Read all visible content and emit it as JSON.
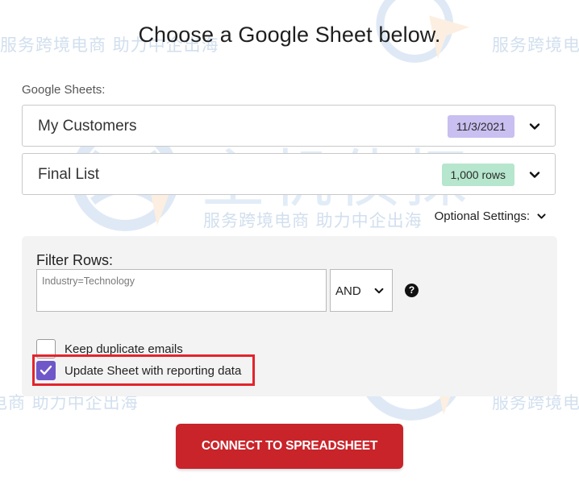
{
  "title": "Choose a Google Sheet below.",
  "sheets_label": "Google Sheets:",
  "sheets": [
    {
      "name": "My Customers",
      "badge": "11/3/2021",
      "badge_color": "#c9bff0"
    },
    {
      "name": "Final List",
      "badge": "1,000 rows",
      "badge_color": "#b6e6cd"
    }
  ],
  "optional_settings": "Optional Settings:",
  "filter": {
    "label": "Filter Rows:",
    "placeholder": "Industry=Technology",
    "operator": "AND",
    "help": "?"
  },
  "options": [
    {
      "label": "Keep duplicate emails",
      "checked": false
    },
    {
      "label": "Update Sheet with reporting data",
      "checked": true
    }
  ],
  "connect_button": "CONNECT TO SPREADSHEET",
  "watermark": {
    "brand": "主机侦探",
    "slogan": "服务跨境电商 助力中企出海"
  },
  "colors": {
    "accent": "#6f57c9",
    "button": "#c8242a",
    "highlight": "#e3232c"
  }
}
